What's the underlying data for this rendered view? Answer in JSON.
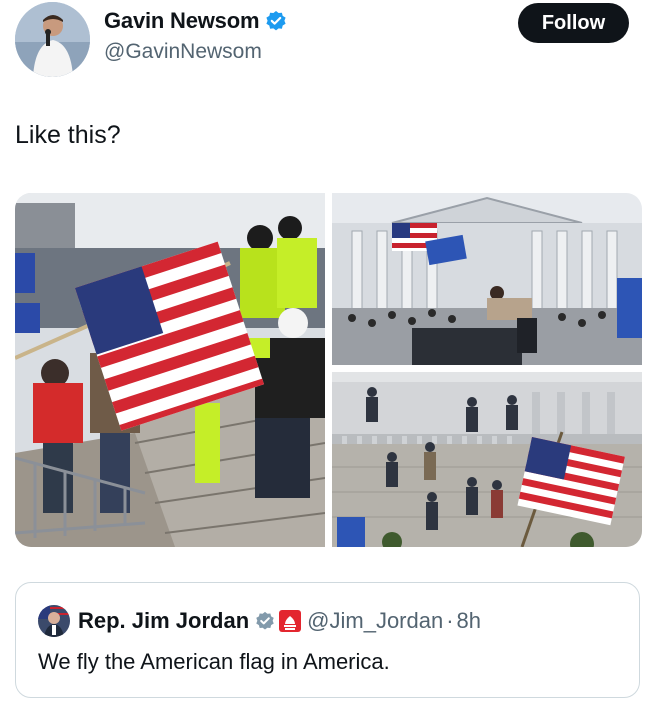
{
  "author": {
    "name": "Gavin Newsom",
    "handle": "@GavinNewsom",
    "verified_icon": "verified-badge-icon",
    "verified_color": "#1d9bf0"
  },
  "follow_button": {
    "label": "Follow"
  },
  "tweet": {
    "text": "Like this?"
  },
  "media": {
    "photo_count": 3,
    "photos": [
      {
        "name": "photo-police-flag-steps"
      },
      {
        "name": "photo-capitol-crowd-flags"
      },
      {
        "name": "photo-capitol-wall-climbers"
      }
    ]
  },
  "quote": {
    "name": "Rep. Jim Jordan",
    "handle": "@Jim_Jordan",
    "separator": "·",
    "time": "8h",
    "text": "We fly the American flag in America.",
    "badge_color": "#e3262f"
  },
  "colors": {
    "text_primary": "#0f1419",
    "text_secondary": "#536471",
    "accent": "#1d9bf0",
    "border": "#cfd9de"
  }
}
